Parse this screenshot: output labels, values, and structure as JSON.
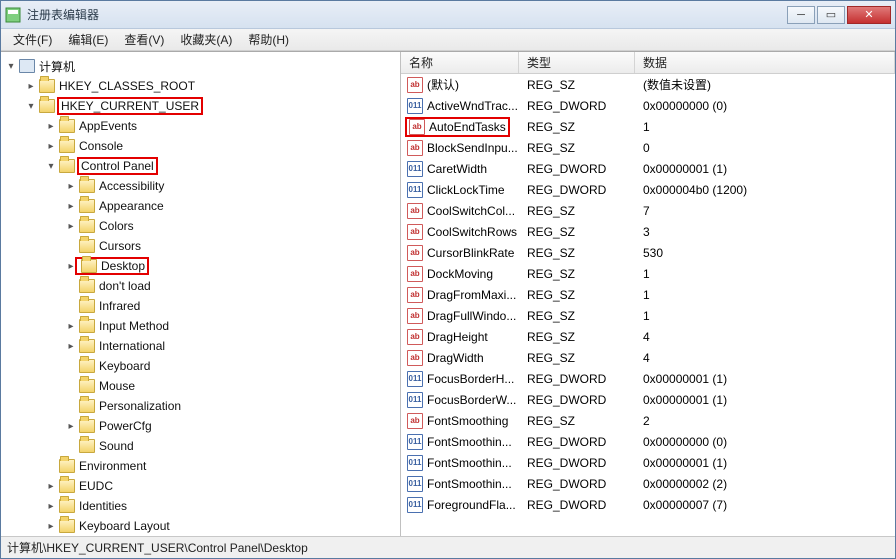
{
  "window": {
    "title": "注册表编辑器"
  },
  "menu": {
    "file": "文件(F)",
    "edit": "编辑(E)",
    "view": "查看(V)",
    "fav": "收藏夹(A)",
    "help": "帮助(H)"
  },
  "tree": {
    "root": "计算机",
    "hkcr": "HKEY_CLASSES_ROOT",
    "hkcu": "HKEY_CURRENT_USER",
    "hkcu_children": {
      "appevents": "AppEvents",
      "console": "Console",
      "controlpanel": "Control Panel",
      "cp_children": {
        "accessibility": "Accessibility",
        "appearance": "Appearance",
        "colors": "Colors",
        "cursors": "Cursors",
        "desktop": "Desktop",
        "dontload": "don't load",
        "infrared": "Infrared",
        "inputmethod": "Input Method",
        "international": "International",
        "keyboard": "Keyboard",
        "mouse": "Mouse",
        "personalization": "Personalization",
        "powercfg": "PowerCfg",
        "sound": "Sound"
      },
      "environment": "Environment",
      "eudc": "EUDC",
      "identities": "Identities",
      "keyboardlayout": "Keyboard Layout"
    }
  },
  "columns": {
    "name": "名称",
    "type": "类型",
    "data": "数据"
  },
  "values": [
    {
      "icon": "sz",
      "name": "(默认)",
      "type": "REG_SZ",
      "data": "(数值未设置)"
    },
    {
      "icon": "dw",
      "name": "ActiveWndTrac...",
      "type": "REG_DWORD",
      "data": "0x00000000 (0)"
    },
    {
      "icon": "sz",
      "name": "AutoEndTasks",
      "type": "REG_SZ",
      "data": "1",
      "highlight": true
    },
    {
      "icon": "sz",
      "name": "BlockSendInpu...",
      "type": "REG_SZ",
      "data": "0"
    },
    {
      "icon": "dw",
      "name": "CaretWidth",
      "type": "REG_DWORD",
      "data": "0x00000001 (1)"
    },
    {
      "icon": "dw",
      "name": "ClickLockTime",
      "type": "REG_DWORD",
      "data": "0x000004b0 (1200)"
    },
    {
      "icon": "sz",
      "name": "CoolSwitchCol...",
      "type": "REG_SZ",
      "data": "7"
    },
    {
      "icon": "sz",
      "name": "CoolSwitchRows",
      "type": "REG_SZ",
      "data": "3"
    },
    {
      "icon": "sz",
      "name": "CursorBlinkRate",
      "type": "REG_SZ",
      "data": "530"
    },
    {
      "icon": "sz",
      "name": "DockMoving",
      "type": "REG_SZ",
      "data": "1"
    },
    {
      "icon": "sz",
      "name": "DragFromMaxi...",
      "type": "REG_SZ",
      "data": "1"
    },
    {
      "icon": "sz",
      "name": "DragFullWindo...",
      "type": "REG_SZ",
      "data": "1"
    },
    {
      "icon": "sz",
      "name": "DragHeight",
      "type": "REG_SZ",
      "data": "4"
    },
    {
      "icon": "sz",
      "name": "DragWidth",
      "type": "REG_SZ",
      "data": "4"
    },
    {
      "icon": "dw",
      "name": "FocusBorderH...",
      "type": "REG_DWORD",
      "data": "0x00000001 (1)"
    },
    {
      "icon": "dw",
      "name": "FocusBorderW...",
      "type": "REG_DWORD",
      "data": "0x00000001 (1)"
    },
    {
      "icon": "sz",
      "name": "FontSmoothing",
      "type": "REG_SZ",
      "data": "2"
    },
    {
      "icon": "dw",
      "name": "FontSmoothin...",
      "type": "REG_DWORD",
      "data": "0x00000000 (0)"
    },
    {
      "icon": "dw",
      "name": "FontSmoothin...",
      "type": "REG_DWORD",
      "data": "0x00000001 (1)"
    },
    {
      "icon": "dw",
      "name": "FontSmoothin...",
      "type": "REG_DWORD",
      "data": "0x00000002 (2)"
    },
    {
      "icon": "dw",
      "name": "ForegroundFla...",
      "type": "REG_DWORD",
      "data": "0x00000007 (7)"
    }
  ],
  "status": {
    "path": "计算机\\HKEY_CURRENT_USER\\Control Panel\\Desktop"
  },
  "icons": {
    "sz_text": "ab",
    "dw_text": "011"
  }
}
